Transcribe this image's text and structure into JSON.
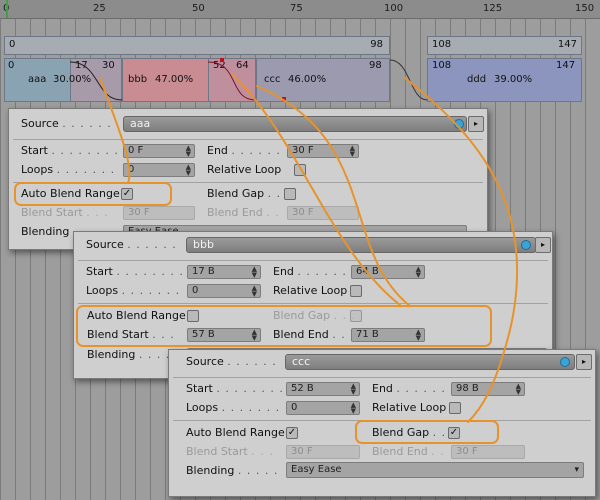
{
  "ruler": {
    "ticks": [
      "0",
      "25",
      "50",
      "75",
      "100",
      "125",
      "150"
    ]
  },
  "tracks": {
    "row1": [
      {
        "start": "0",
        "end": "98"
      },
      {
        "start": "108",
        "end": "147"
      }
    ],
    "row2": [
      {
        "start": "0",
        "end": "98"
      },
      {
        "start": "108",
        "end": "147"
      }
    ],
    "inner_marks": [
      "17",
      "30",
      "52",
      "64"
    ],
    "clips": [
      {
        "name": "aaa",
        "pct": "30.00%"
      },
      {
        "name": "bbb",
        "pct": "47.00%"
      },
      {
        "name": "ccc",
        "pct": "46.00%"
      },
      {
        "name": "ddd",
        "pct": "39.00%"
      }
    ]
  },
  "panels": [
    {
      "source_label": "Source",
      "source_value": "aaa",
      "start_label": "Start",
      "start_value": "0 F",
      "end_label": "End",
      "end_value": "30 F",
      "loops_label": "Loops",
      "loops_value": "0",
      "relative_loop_label": "Relative Loop",
      "auto_blend_label": "Auto Blend Range",
      "blend_gap_label": "Blend Gap",
      "blend_start_label": "Blend Start",
      "blend_start_value": "30 F",
      "blend_end_label": "Blend End",
      "blend_end_value": "30 F",
      "blending_label": "Blending",
      "blending_value": "Easy Ease"
    },
    {
      "source_label": "Source",
      "source_value": "bbb",
      "start_label": "Start",
      "start_value": "17 B",
      "end_label": "End",
      "end_value": "64 B",
      "loops_label": "Loops",
      "loops_value": "0",
      "relative_loop_label": "Relative Loop",
      "auto_blend_label": "Auto Blend Range",
      "blend_gap_label": "Blend Gap",
      "blend_start_label": "Blend Start",
      "blend_start_value": "57 B",
      "blend_end_label": "Blend End",
      "blend_end_value": "71 B",
      "blending_label": "Blending"
    },
    {
      "source_label": "Source",
      "source_value": "ccc",
      "start_label": "Start",
      "start_value": "52 B",
      "end_label": "End",
      "end_value": "98 B",
      "loops_label": "Loops",
      "loops_value": "0",
      "relative_loop_label": "Relative Loop",
      "auto_blend_label": "Auto Blend Range",
      "blend_gap_label": "Blend Gap",
      "blend_start_label": "Blend Start",
      "blend_start_value": "30 F",
      "blend_end_label": "Blend End",
      "blend_end_value": "30 F",
      "blending_label": "Blending",
      "blending_value": "Easy Ease"
    }
  ],
  "colors": {
    "clip_aaa": "#8aa3b3",
    "clip_bbb": "#c98c93",
    "clip_ccc": "#9c9aaf",
    "clip_ddd": "#8b95bd",
    "highlight": "#e6932c"
  }
}
